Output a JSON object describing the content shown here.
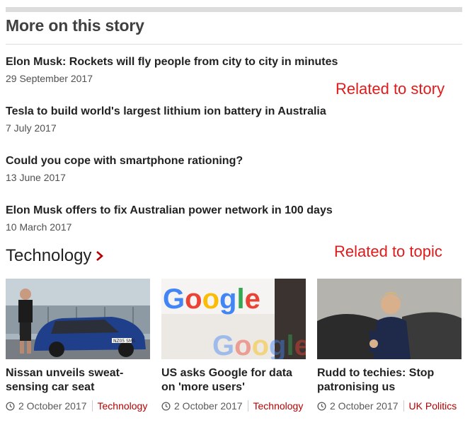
{
  "section": {
    "title": "More on this story"
  },
  "stories": [
    {
      "title": "Elon Musk: Rockets will fly people from city to city in minutes",
      "date": "29 September 2017"
    },
    {
      "title": "Tesla to build world's largest lithium ion battery in Australia",
      "date": "7 July 2017"
    },
    {
      "title": "Could you cope with smartphone rationing?",
      "date": "13 June 2017"
    },
    {
      "title": "Elon Musk offers to fix Australian power network in 100 days",
      "date": "10 March 2017"
    }
  ],
  "annotations": {
    "story": "Related to story",
    "topic": "Related to topic"
  },
  "topic": {
    "label": "Technology",
    "icon": "chevron-right-icon"
  },
  "cards": [
    {
      "title": "Nissan unveils sweat-sensing car seat",
      "date": "2 October 2017",
      "tag": "Technology",
      "image_text": "NZ05 SMS"
    },
    {
      "title": "US asks Google for data on 'more users'",
      "date": "2 October 2017",
      "tag": "Technology",
      "image_text": "Google"
    },
    {
      "title": "Rudd to techies: Stop patronising us",
      "date": "2 October 2017",
      "tag": "UK Politics"
    }
  ],
  "colors": {
    "accent": "#b80000",
    "annotation": "#e21a1a",
    "rule": "#dcdcdc",
    "text": "#222222"
  }
}
